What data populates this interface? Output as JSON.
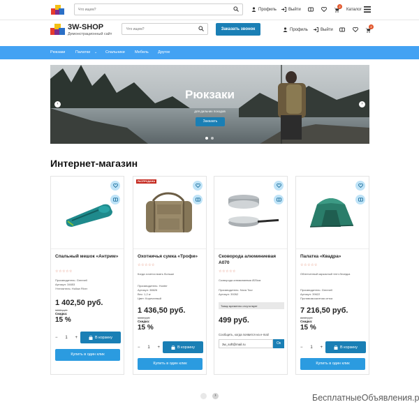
{
  "topbar": {
    "search_placeholder": "Что ищем?",
    "profile": "Профиль",
    "logout": "Выйти",
    "cart_count": "2",
    "catalog": "Каталог"
  },
  "header": {
    "logo_title": "3W-SHOP",
    "logo_subtitle": "Демонстрационный сайт",
    "search_placeholder": "Что ищем?",
    "call_button": "Заказать звонок",
    "profile": "Профиль",
    "logout": "Выйти",
    "cart_count": "2"
  },
  "nav": {
    "items": [
      "Рюкзаки",
      "Палатки",
      "Спальники",
      "Мебель",
      "Другое"
    ]
  },
  "banner": {
    "title": "Рюкзаки",
    "subtitle": "для дальних походов",
    "button": "Заказать"
  },
  "section_title": "Интернет-магазин",
  "products": [
    {
      "name": "Спальный мешок «Антрим»",
      "details": [
        "Производитель: Greenell",
        "Артикул: 34653",
        "Утеплитель: Hollow Fiber"
      ],
      "price": "1 402,50 руб.",
      "old_price": "1650 руб.",
      "save_label": "Скидка:",
      "discount": "15 %",
      "qty": "1",
      "cart_button": "В корзину",
      "buy_button": "Купить в один клик"
    },
    {
      "name": "Охотничья сумка «Трофи»",
      "sale_tag": "РАСПРОДАЖА",
      "details": [
        "Когда хочется взять больше",
        "",
        "Производитель: Hunter",
        "Артикул: 38626",
        "Вес: 1,2 кг",
        "Цвет: Коричневый"
      ],
      "price": "1 436,50 руб.",
      "old_price": "1690 руб.",
      "save_label": "Скидка:",
      "discount": "15 %",
      "qty": "1",
      "cart_button": "В корзину",
      "buy_button": "Купить в один клик"
    },
    {
      "name": "Сковорода алюминиевая А070",
      "details": [
        "Сковорода алюминиевая Ø25см",
        "",
        "Производитель: Nova Tour",
        "Артикул: 39262"
      ],
      "stock": "Товар временно отсутствует",
      "price": "499 руб.",
      "notify_text": "Сообщить, когда появится на e-mail",
      "email": "3w_soft@mail.ru",
      "ok": "Ок"
    },
    {
      "name": "Палатка «Квадра»",
      "details": [
        "Облегченный каркасный тент-беседка",
        "",
        "Производитель: Greenell",
        "Артикул: 39622",
        "Противомоскитная сетка"
      ],
      "price": "7 216,50 руб.",
      "old_price": "8490 руб.",
      "save_label": "Скидка:",
      "discount": "15 %",
      "qty": "1",
      "cart_button": "В корзину",
      "buy_button": "Купить в один клик"
    }
  ],
  "watermark": "БесплатныеОбъявления.рф",
  "colors": {
    "primary": "#1a7fb5",
    "nav": "#43a2f3",
    "accent_badge": "#e2562b",
    "button_light": "#2b9be0"
  }
}
